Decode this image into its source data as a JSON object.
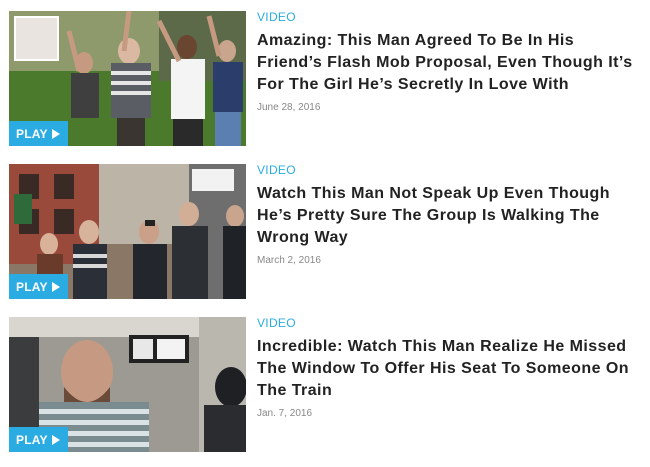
{
  "colors": {
    "accent": "#2aace2",
    "headline": "#222222",
    "date": "#888888"
  },
  "articles": [
    {
      "category": "VIDEO",
      "title": "Amazing: This Man Agreed To Be In His Friend’s Flash Mob Proposal, Even Though It’s For The Girl He’s Secretly In Love With",
      "date": "June 28, 2016",
      "play_label": "PLAY",
      "icon": "play-icon"
    },
    {
      "category": "VIDEO",
      "title": "Watch This Man Not Speak Up Even Though He’s Pretty Sure The Group Is Walking The Wrong Way",
      "date": "March 2, 2016",
      "play_label": "PLAY",
      "icon": "play-icon"
    },
    {
      "category": "VIDEO",
      "title": "Incredible: Watch This Man Realize He Missed The Window To Offer His Seat To Someone On The Train",
      "date": "Jan. 7, 2016",
      "play_label": "PLAY",
      "icon": "play-icon"
    }
  ]
}
